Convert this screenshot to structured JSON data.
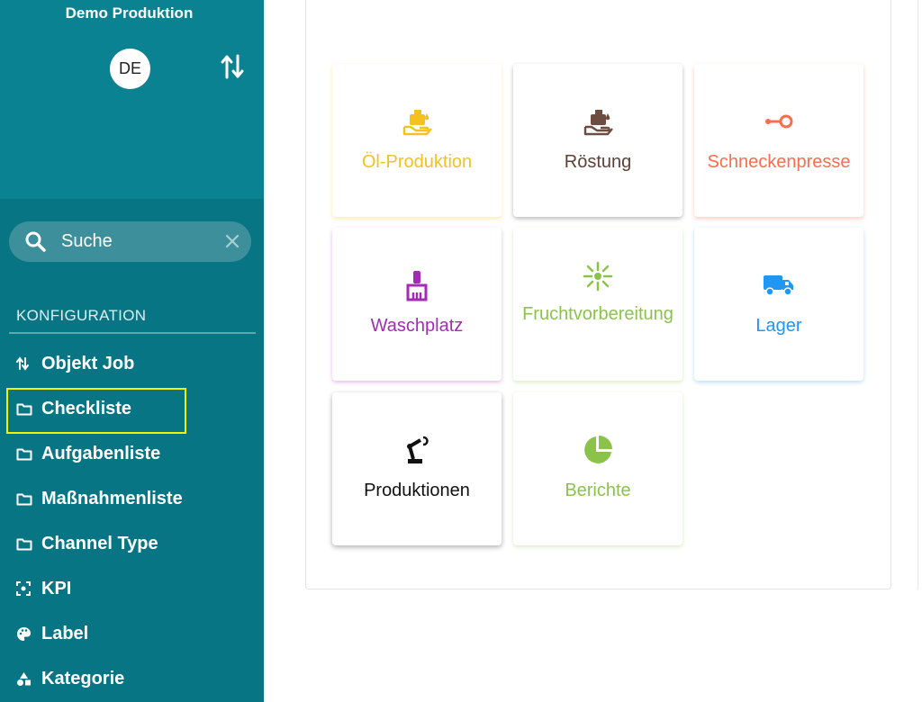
{
  "sidebar": {
    "org_name": "Demo Produktion",
    "avatar_initials": "DE",
    "search": {
      "placeholder": "Suche",
      "value": ""
    },
    "section_title": "KONFIGURATION",
    "items": [
      {
        "label": "Objekt Job",
        "icon": "sort-arrows-icon"
      },
      {
        "label": "Checkliste",
        "icon": "folder-icon"
      },
      {
        "label": "Aufgabenliste",
        "icon": "folder-icon"
      },
      {
        "label": "Maßnahmenliste",
        "icon": "folder-icon"
      },
      {
        "label": "Channel Type",
        "icon": "folder-icon"
      },
      {
        "label": "KPI",
        "icon": "scan-icon"
      },
      {
        "label": "Label",
        "icon": "palette-icon"
      },
      {
        "label": "Kategorie",
        "icon": "shapes-icon"
      }
    ],
    "highlighted_item": "Checkliste",
    "colors": {
      "background": "#087584",
      "top": "#0a8292",
      "highlight": "#f2f200"
    }
  },
  "tiles": [
    {
      "label": "Öl-Produktion",
      "icon": "oil-hand-icon",
      "color": "#f5c11e"
    },
    {
      "label": "Röstung",
      "icon": "oil-hand-icon",
      "color": "#6d4c41"
    },
    {
      "label": "Schneckenpresse",
      "icon": "key-icon",
      "color": "#fb6d4c"
    },
    {
      "label": "Waschplatz",
      "icon": "brush-icon",
      "color": "#a42bb5"
    },
    {
      "label": "Fruchtvorbereitung",
      "icon": "spark-icon",
      "color": "#8bc34a"
    },
    {
      "label": "Lager",
      "icon": "truck-icon",
      "color": "#2196f3"
    },
    {
      "label": "Produktionen",
      "icon": "robot-arm-icon",
      "color": "#111111"
    },
    {
      "label": "Berichte",
      "icon": "pie-chart-icon",
      "color": "#8bc34a"
    }
  ]
}
